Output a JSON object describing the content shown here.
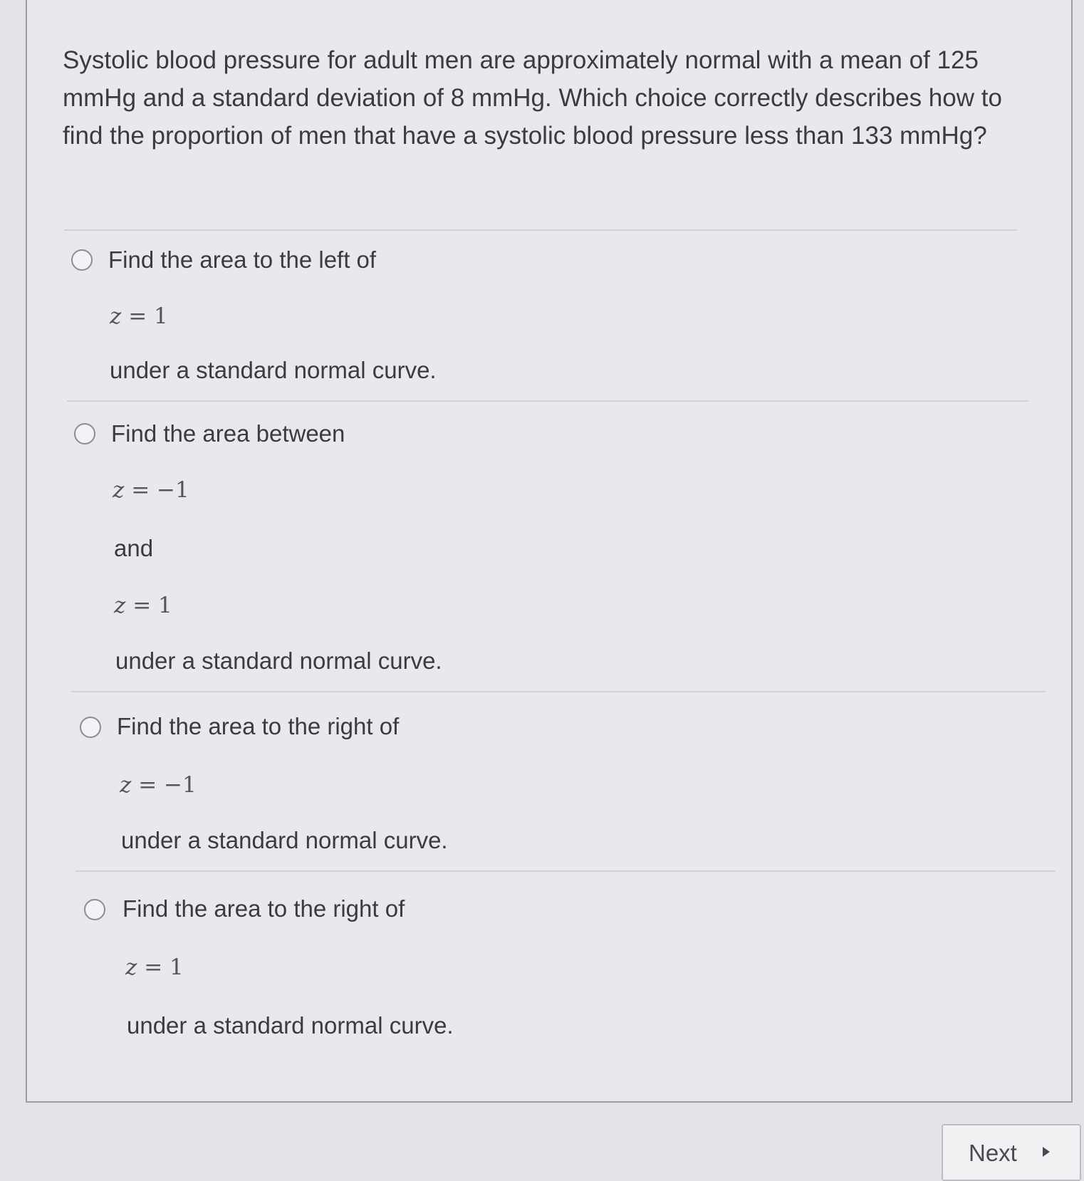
{
  "question": {
    "text": "Systolic blood pressure for adult men are approximately normal with a mean of 125 mmHg and a standard deviation of 8 mmHg. Which choice correctly describes how to find the proportion of men that have a systolic blood pressure less than 133 mmHg?"
  },
  "options": [
    {
      "prefix": "Find the area to the left of",
      "z1_var": "z",
      "z1_rest": " = 1",
      "suffix": "under a standard normal curve."
    },
    {
      "prefix": "Find the area between",
      "z1_var": "z",
      "z1_rest": " = −1",
      "connector": "and",
      "z2_var": "z",
      "z2_rest": " = 1",
      "suffix": "under a standard normal curve."
    },
    {
      "prefix": "Find the area to the right of",
      "z1_var": "z",
      "z1_rest": " = −1",
      "suffix": "under a standard normal curve."
    },
    {
      "prefix": "Find the area to the right of",
      "z1_var": "z",
      "z1_rest": " = 1",
      "suffix": "under a standard normal curve."
    }
  ],
  "navigation": {
    "next_label": "Next"
  }
}
